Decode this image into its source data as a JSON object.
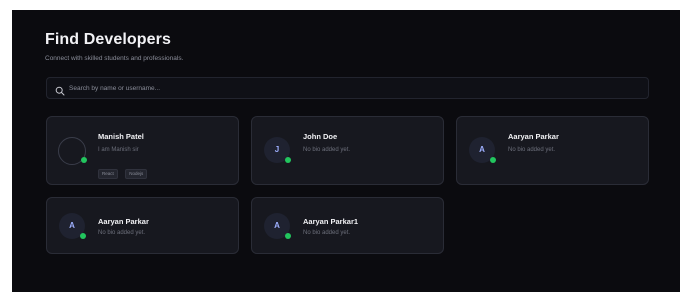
{
  "header": {
    "title": "Find Developers",
    "subtitle": "Connect with skilled students and professionals."
  },
  "search": {
    "placeholder": "Search by name or username...",
    "icon": "search-icon"
  },
  "developers": [
    {
      "name": "Manish Patel",
      "bio": "I am Manish sir",
      "initial": "",
      "online": true,
      "tags": [
        "React",
        "Nodejs"
      ]
    },
    {
      "name": "John Doe",
      "bio": "No bio added yet.",
      "initial": "J",
      "online": true,
      "tags": []
    },
    {
      "name": "Aaryan Parkar",
      "bio": "No bio added yet.",
      "initial": "A",
      "online": true,
      "tags": []
    },
    {
      "name": "Aaryan Parkar",
      "bio": "No bio added yet.",
      "initial": "A",
      "online": true,
      "tags": []
    },
    {
      "name": "Aaryan Parkar1",
      "bio": "No bio added yet.",
      "initial": "A",
      "online": true,
      "tags": []
    }
  ],
  "colors": {
    "background": "#0b0b0f",
    "card": "#17181f",
    "online": "#22c55e",
    "initial": "#9fb0ff"
  }
}
